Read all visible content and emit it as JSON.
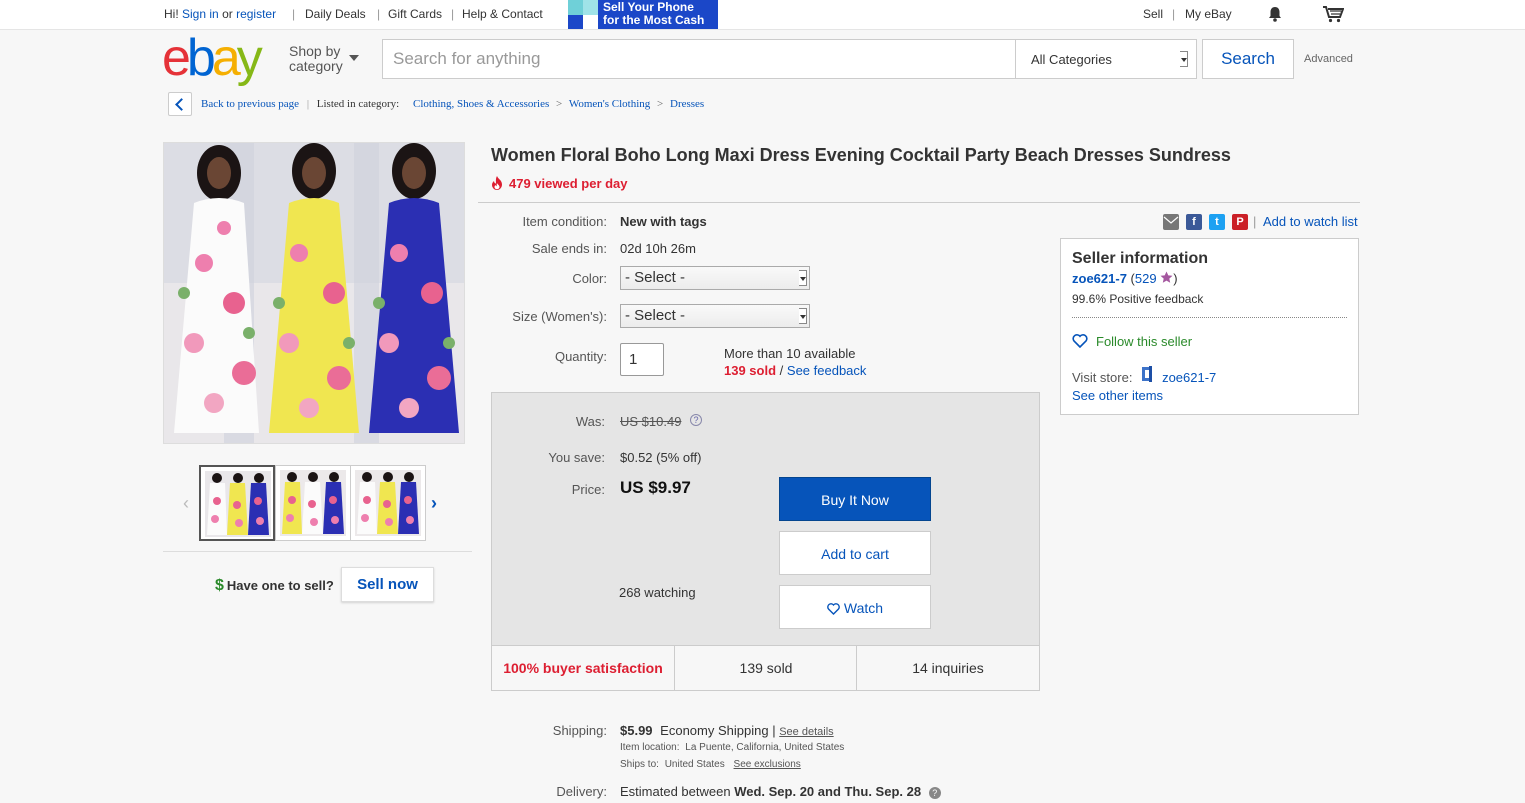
{
  "topbar": {
    "greeting": "Hi!",
    "sign_in": "Sign in",
    "or": "or",
    "register": "register",
    "links": [
      "Daily Deals",
      "Gift Cards",
      "Help & Contact"
    ],
    "promo_line1": "Sell Your Phone",
    "promo_line2": "for the Most Cash",
    "sell": "Sell",
    "my_ebay": "My eBay"
  },
  "header": {
    "logo_letters": [
      "e",
      "b",
      "a",
      "y"
    ],
    "shop_by_line1": "Shop by",
    "shop_by_line2": "category",
    "search_placeholder": "Search for anything",
    "category": "All Categories",
    "search_button": "Search",
    "advanced": "Advanced"
  },
  "breadcrumb": {
    "back": "Back to previous page",
    "listed_in": "Listed in category:",
    "items": [
      "Clothing, Shoes & Accessories",
      "Women's Clothing",
      "Dresses"
    ]
  },
  "gallery": {
    "have_one": "Have one to sell?",
    "sell_now": "Sell now"
  },
  "listing": {
    "title": "Women Floral Boho Long Maxi Dress Evening Cocktail Party Beach Dresses Sundress",
    "viewed": "479 viewed per day",
    "condition_label": "Item condition:",
    "condition": "New with tags",
    "sale_ends_label": "Sale ends in:",
    "sale_ends": "02d 10h 26m",
    "color_label": "Color:",
    "color_value": "- Select -",
    "size_label": "Size (Women's):",
    "size_value": "- Select -",
    "quantity_label": "Quantity:",
    "quantity": "1",
    "available": "More than 10 available",
    "sold": "139 sold",
    "slash": "/",
    "see_feedback": "See feedback"
  },
  "buybox": {
    "was_label": "Was:",
    "was": "US $10.49",
    "save_label": "You save:",
    "save": "$0.52 (5% off)",
    "price_label": "Price:",
    "price": "US $9.97",
    "watching": "268 watching",
    "buy_now": "Buy It Now",
    "add_to_cart": "Add to cart",
    "watch": "Watch",
    "satisfaction": "100% buyer satisfaction",
    "sold": "139 sold",
    "inquiries": "14 inquiries"
  },
  "share": {
    "add_watch": "Add to watch list"
  },
  "seller": {
    "heading": "Seller information",
    "name": "zoe621-7",
    "score": "529",
    "feedback": "99.6% Positive feedback",
    "follow": "Follow this seller",
    "visit_store": "Visit store:",
    "store_name": "zoe621-7",
    "other_items": "See other items"
  },
  "shipping": {
    "label": "Shipping:",
    "cost": "$5.99",
    "method": "Economy Shipping",
    "sep": "|",
    "see_details": "See details",
    "location_label": "Item location:",
    "location": "La Puente, California, United States",
    "ships_to_label": "Ships to:",
    "ships_to": "United States",
    "see_exclusions": "See exclusions",
    "delivery_label": "Delivery:",
    "delivery_prefix": "Estimated between",
    "delivery_dates": "Wed. Sep. 20 and Thu. Sep. 28"
  },
  "colors": {
    "brand_blue": "#0654ba",
    "alert_red": "#dd1e31",
    "follow_green": "#2a8a2a"
  }
}
